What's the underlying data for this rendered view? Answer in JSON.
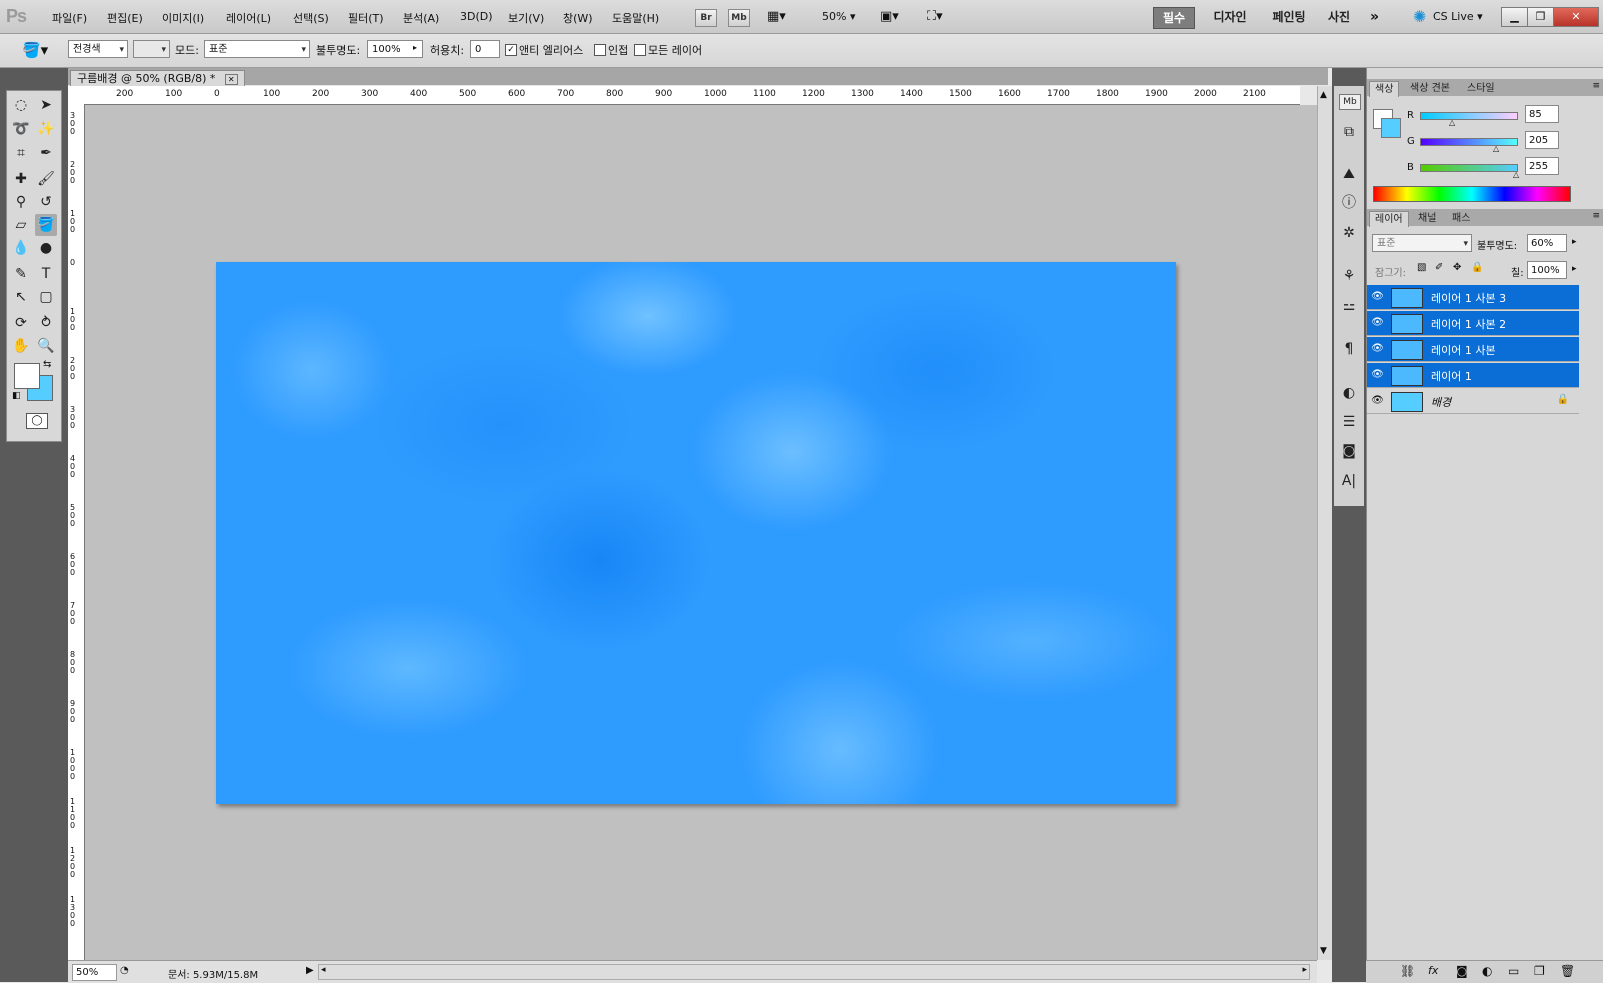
{
  "app": {
    "logo": "Ps"
  },
  "menu": [
    "파일(F)",
    "편집(E)",
    "이미지(I)",
    "레이어(L)",
    "선택(S)",
    "필터(T)",
    "분석(A)",
    "3D(D)",
    "보기(V)",
    "창(W)",
    "도움말(H)"
  ],
  "appbar": {
    "br": "Br",
    "mb": "Mb",
    "zoom": "50%"
  },
  "workspaces": [
    "필수",
    "디자인",
    "페인팅",
    "사진"
  ],
  "cs_live": "CS Live",
  "options": {
    "fill_source": "전경색",
    "mode_label": "모드:",
    "mode_value": "표준",
    "opacity_label": "불투명도:",
    "opacity_value": "100%",
    "tolerance_label": "허용치:",
    "tolerance_value": "0",
    "antialias_label": "앤티 엘리어스",
    "antialias_checked": true,
    "contiguous_label": "인접",
    "all_layers_label": "모든 레이어"
  },
  "document": {
    "tab_label": "구름배경 @ 50% (RGB/8) *",
    "ruler_top": [
      "200",
      "100",
      "0",
      "100",
      "200",
      "300",
      "400",
      "500",
      "600",
      "700",
      "800",
      "900",
      "1000",
      "1100",
      "1200",
      "1300",
      "1400",
      "1500",
      "1600",
      "1700",
      "1800",
      "1900",
      "2000",
      "2100"
    ],
    "ruler_left": [
      "300",
      "200",
      "100",
      "0",
      "100",
      "200",
      "300",
      "400",
      "500",
      "600",
      "700",
      "800",
      "900",
      "1000",
      "1100",
      "1200",
      "1300"
    ],
    "canvas_color": "#2e9bff"
  },
  "status": {
    "zoom": "50%",
    "doc_info": "문서: 5.93M/15.8M"
  },
  "color_panel": {
    "tabs": [
      "색상",
      "색상 견본",
      "스타일"
    ],
    "r_label": "R",
    "g_label": "G",
    "b_label": "B",
    "r": "85",
    "g": "205",
    "b": "255",
    "fg_color": "#ffffff",
    "bg_color": "#55cdff"
  },
  "layers_panel": {
    "tabs": [
      "레이어",
      "채널",
      "패스"
    ],
    "blend_mode": "표준",
    "opacity_label": "불투명도:",
    "opacity_value": "60%",
    "lock_label": "잠그기:",
    "fill_label": "칠:",
    "fill_value": "100%",
    "layers": [
      {
        "name": "레이어 1 사본 3",
        "selected": true
      },
      {
        "name": "레이어 1 사본 2",
        "selected": true
      },
      {
        "name": "레이어 1 사본",
        "selected": true
      },
      {
        "name": "레이어 1",
        "selected": true
      },
      {
        "name": "배경",
        "selected": false,
        "locked": true
      }
    ],
    "footer_icons": [
      "link-icon",
      "fx-icon",
      "mask-icon",
      "adjustment-icon",
      "group-icon",
      "new-layer-icon",
      "trash-icon"
    ]
  }
}
